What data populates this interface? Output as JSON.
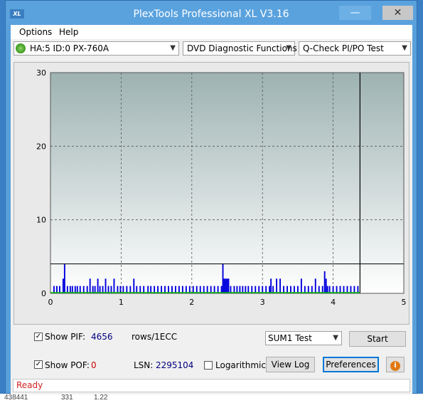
{
  "window": {
    "title": "PlexTools Professional XL V3.16",
    "icon_text": "XL",
    "min_glyph": "—",
    "max_glyph": "☐",
    "close_glyph": "✕"
  },
  "menu": {
    "items": [
      "Options",
      "Help"
    ]
  },
  "toolbar": {
    "drive": "HA:5 ID:0  PX-760A",
    "function": "DVD Diagnostic Functions",
    "test": "Q-Check PI/PO Test"
  },
  "chart_data": {
    "type": "bar",
    "x_ticks": [
      "0",
      "1",
      "2",
      "3",
      "4",
      "5"
    ],
    "y_ticks": [
      "0",
      "10",
      "20",
      "30"
    ],
    "xlim": [
      0,
      5
    ],
    "ylim": [
      0,
      30
    ],
    "grid": true,
    "threshold_line": 4,
    "marker_x": 4.38,
    "series": [
      {
        "color": "#0000dd",
        "x": [
          0.05,
          0.09,
          0.13,
          0.18,
          0.2,
          0.24,
          0.28,
          0.31,
          0.35,
          0.38,
          0.42,
          0.47,
          0.52,
          0.56,
          0.6,
          0.63,
          0.67,
          0.7,
          0.74,
          0.78,
          0.82,
          0.86,
          0.9,
          0.95,
          0.99,
          1.03,
          1.08,
          1.13,
          1.18,
          1.22,
          1.27,
          1.32,
          1.38,
          1.42,
          1.47,
          1.52,
          1.57,
          1.62,
          1.67,
          1.72,
          1.77,
          1.82,
          1.87,
          1.92,
          1.97,
          2.02,
          2.07,
          2.12,
          2.17,
          2.22,
          2.27,
          2.32,
          2.37,
          2.42,
          2.44,
          2.46,
          2.48,
          2.5,
          2.52,
          2.55,
          2.6,
          2.64,
          2.68,
          2.72,
          2.76,
          2.8,
          2.85,
          2.9,
          2.95,
          3.0,
          3.05,
          3.1,
          3.12,
          3.15,
          3.2,
          3.25,
          3.3,
          3.35,
          3.4,
          3.45,
          3.5,
          3.55,
          3.6,
          3.65,
          3.7,
          3.75,
          3.8,
          3.85,
          3.88,
          3.9,
          3.92,
          3.95,
          4.0,
          4.05,
          4.1,
          4.15,
          4.2,
          4.25,
          4.3,
          4.35
        ],
        "values": [
          1,
          1,
          1,
          2,
          4,
          1,
          1,
          1,
          1,
          1,
          1,
          1,
          1,
          2,
          1,
          1,
          2,
          1,
          1,
          2,
          1,
          1,
          2,
          1,
          1,
          1,
          1,
          1,
          2,
          1,
          1,
          1,
          1,
          1,
          1,
          1,
          1,
          1,
          1,
          1,
          1,
          1,
          1,
          1,
          1,
          1,
          1,
          1,
          1,
          1,
          1,
          1,
          1,
          1,
          4,
          2,
          2,
          2,
          2,
          1,
          1,
          1,
          1,
          1,
          1,
          1,
          1,
          1,
          1,
          1,
          1,
          1,
          2,
          1,
          2,
          2,
          1,
          1,
          1,
          1,
          1,
          2,
          1,
          1,
          1,
          2,
          1,
          1,
          3,
          2,
          1,
          1,
          1,
          1,
          1,
          1,
          1,
          1,
          1,
          1
        ]
      }
    ]
  },
  "controls": {
    "show_pif_label": "Show PIF:",
    "pif_value": "4656",
    "pif_unit": "rows/1ECC",
    "show_pof_label": "Show POF:",
    "pof_value": "0",
    "lsn_label": "LSN:",
    "lsn_value": "2295104",
    "log_label": "Logarithmic",
    "sum_select": "SUM1 Test",
    "start_button": "Start",
    "viewlog_button": "View Log",
    "prefs_button": "Preferences",
    "info_glyph": "i",
    "check_glyph": "✓"
  },
  "status": {
    "text": "Ready"
  },
  "background_text": {
    "col1": "438441",
    "col2": "331",
    "col3": "1.22"
  }
}
